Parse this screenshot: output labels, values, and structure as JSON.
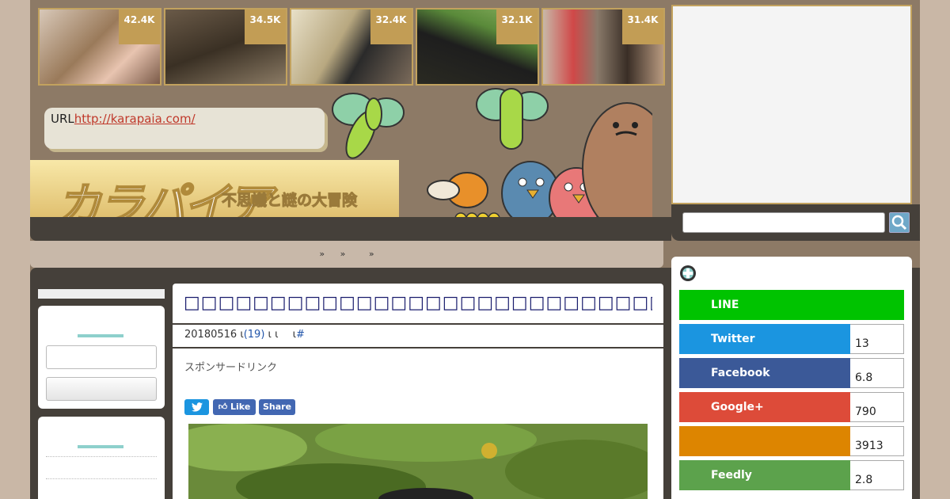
{
  "thumbnails": [
    {
      "count": "42.4K",
      "colors": [
        "#c9b9a9",
        "#8a6a50",
        "#e8d4c4"
      ]
    },
    {
      "count": "34.5K",
      "colors": [
        "#5a4a3a",
        "#3a3024",
        "#7a6a58"
      ]
    },
    {
      "count": "32.4K",
      "colors": [
        "#d8d0b8",
        "#3a3a3a",
        "#9a7a5a"
      ]
    },
    {
      "count": "32.1K",
      "colors": [
        "#6a9a4a",
        "#1e1e1e",
        "#7ab04a"
      ]
    },
    {
      "count": "31.4K",
      "colors": [
        "#b8a898",
        "#4a3a30",
        "#d04040"
      ]
    }
  ],
  "url_box": {
    "prefix": "URL",
    "link": "http://karapaia.com/"
  },
  "logo": {
    "name": "カラパイア",
    "tagline": "不思議と謎の大冒険"
  },
  "nav": {
    "sep1": "»",
    "sep2": "»",
    "sep3": "»"
  },
  "article": {
    "title": "□□□□□□□□□□□□□□□□□□□□□□□□□□□□□□□□□□□□□□□□□□□□",
    "meta": {
      "date": "20180516",
      "a": "ι",
      "comments": "(19)",
      "b": "ι ι",
      "c": "ι",
      "hash": "#"
    },
    "sponsor": "スポンサードリンク",
    "share": {
      "twitter_icon": "twitter-bird-icon",
      "like": "Like",
      "share": "Share"
    }
  },
  "colors": {
    "line": "#00c300",
    "twitter": "#1b95e0",
    "facebook": "#3b5998",
    "googleplus": "#dd4b39",
    "hatena": "#dd8500",
    "feedly": "#5ca24c",
    "accent": "#8ed0cc"
  },
  "social": [
    {
      "label": "LINE",
      "count": null,
      "color": "#00c300"
    },
    {
      "label": "Twitter",
      "count": "13",
      "color": "#1b95e0"
    },
    {
      "label": "Facebook",
      "count": "6.8",
      "color": "#3b5998"
    },
    {
      "label": "Google+",
      "count": "790",
      "color": "#dd4b39"
    },
    {
      "label": "",
      "count": "3913",
      "color": "#dd8500"
    },
    {
      "label": "Feedly",
      "count": "2.8",
      "color": "#5ca24c"
    }
  ]
}
